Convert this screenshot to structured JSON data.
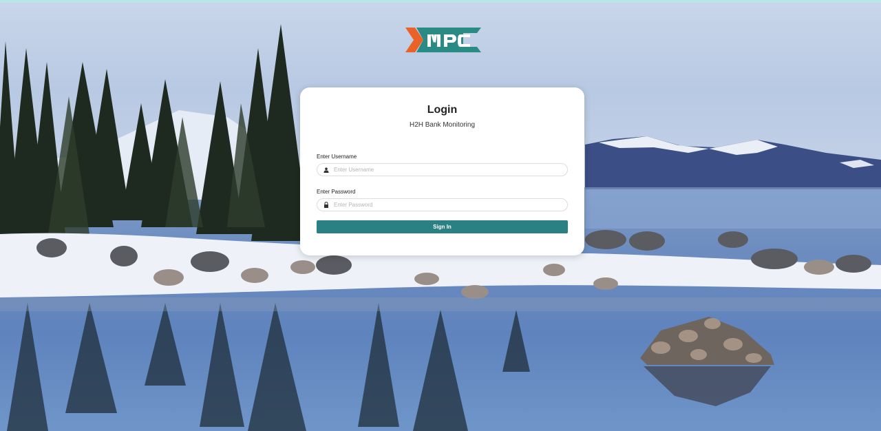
{
  "brand": {
    "logo_text": "MPC",
    "logo_colors": {
      "chevron": "#e8622a",
      "letters": "#2a8a84"
    }
  },
  "login": {
    "title": "Login",
    "subtitle": "H2H Bank Monitoring",
    "username": {
      "label": "Enter Username",
      "placeholder": "Enter Username",
      "value": "",
      "icon": "user-icon"
    },
    "password": {
      "label": "Enter Password",
      "placeholder": "Enter Password",
      "value": "",
      "icon": "lock-icon"
    },
    "submit_label": "Sign In"
  },
  "colors": {
    "accent": "#2a8082",
    "card": "#ffffff"
  }
}
